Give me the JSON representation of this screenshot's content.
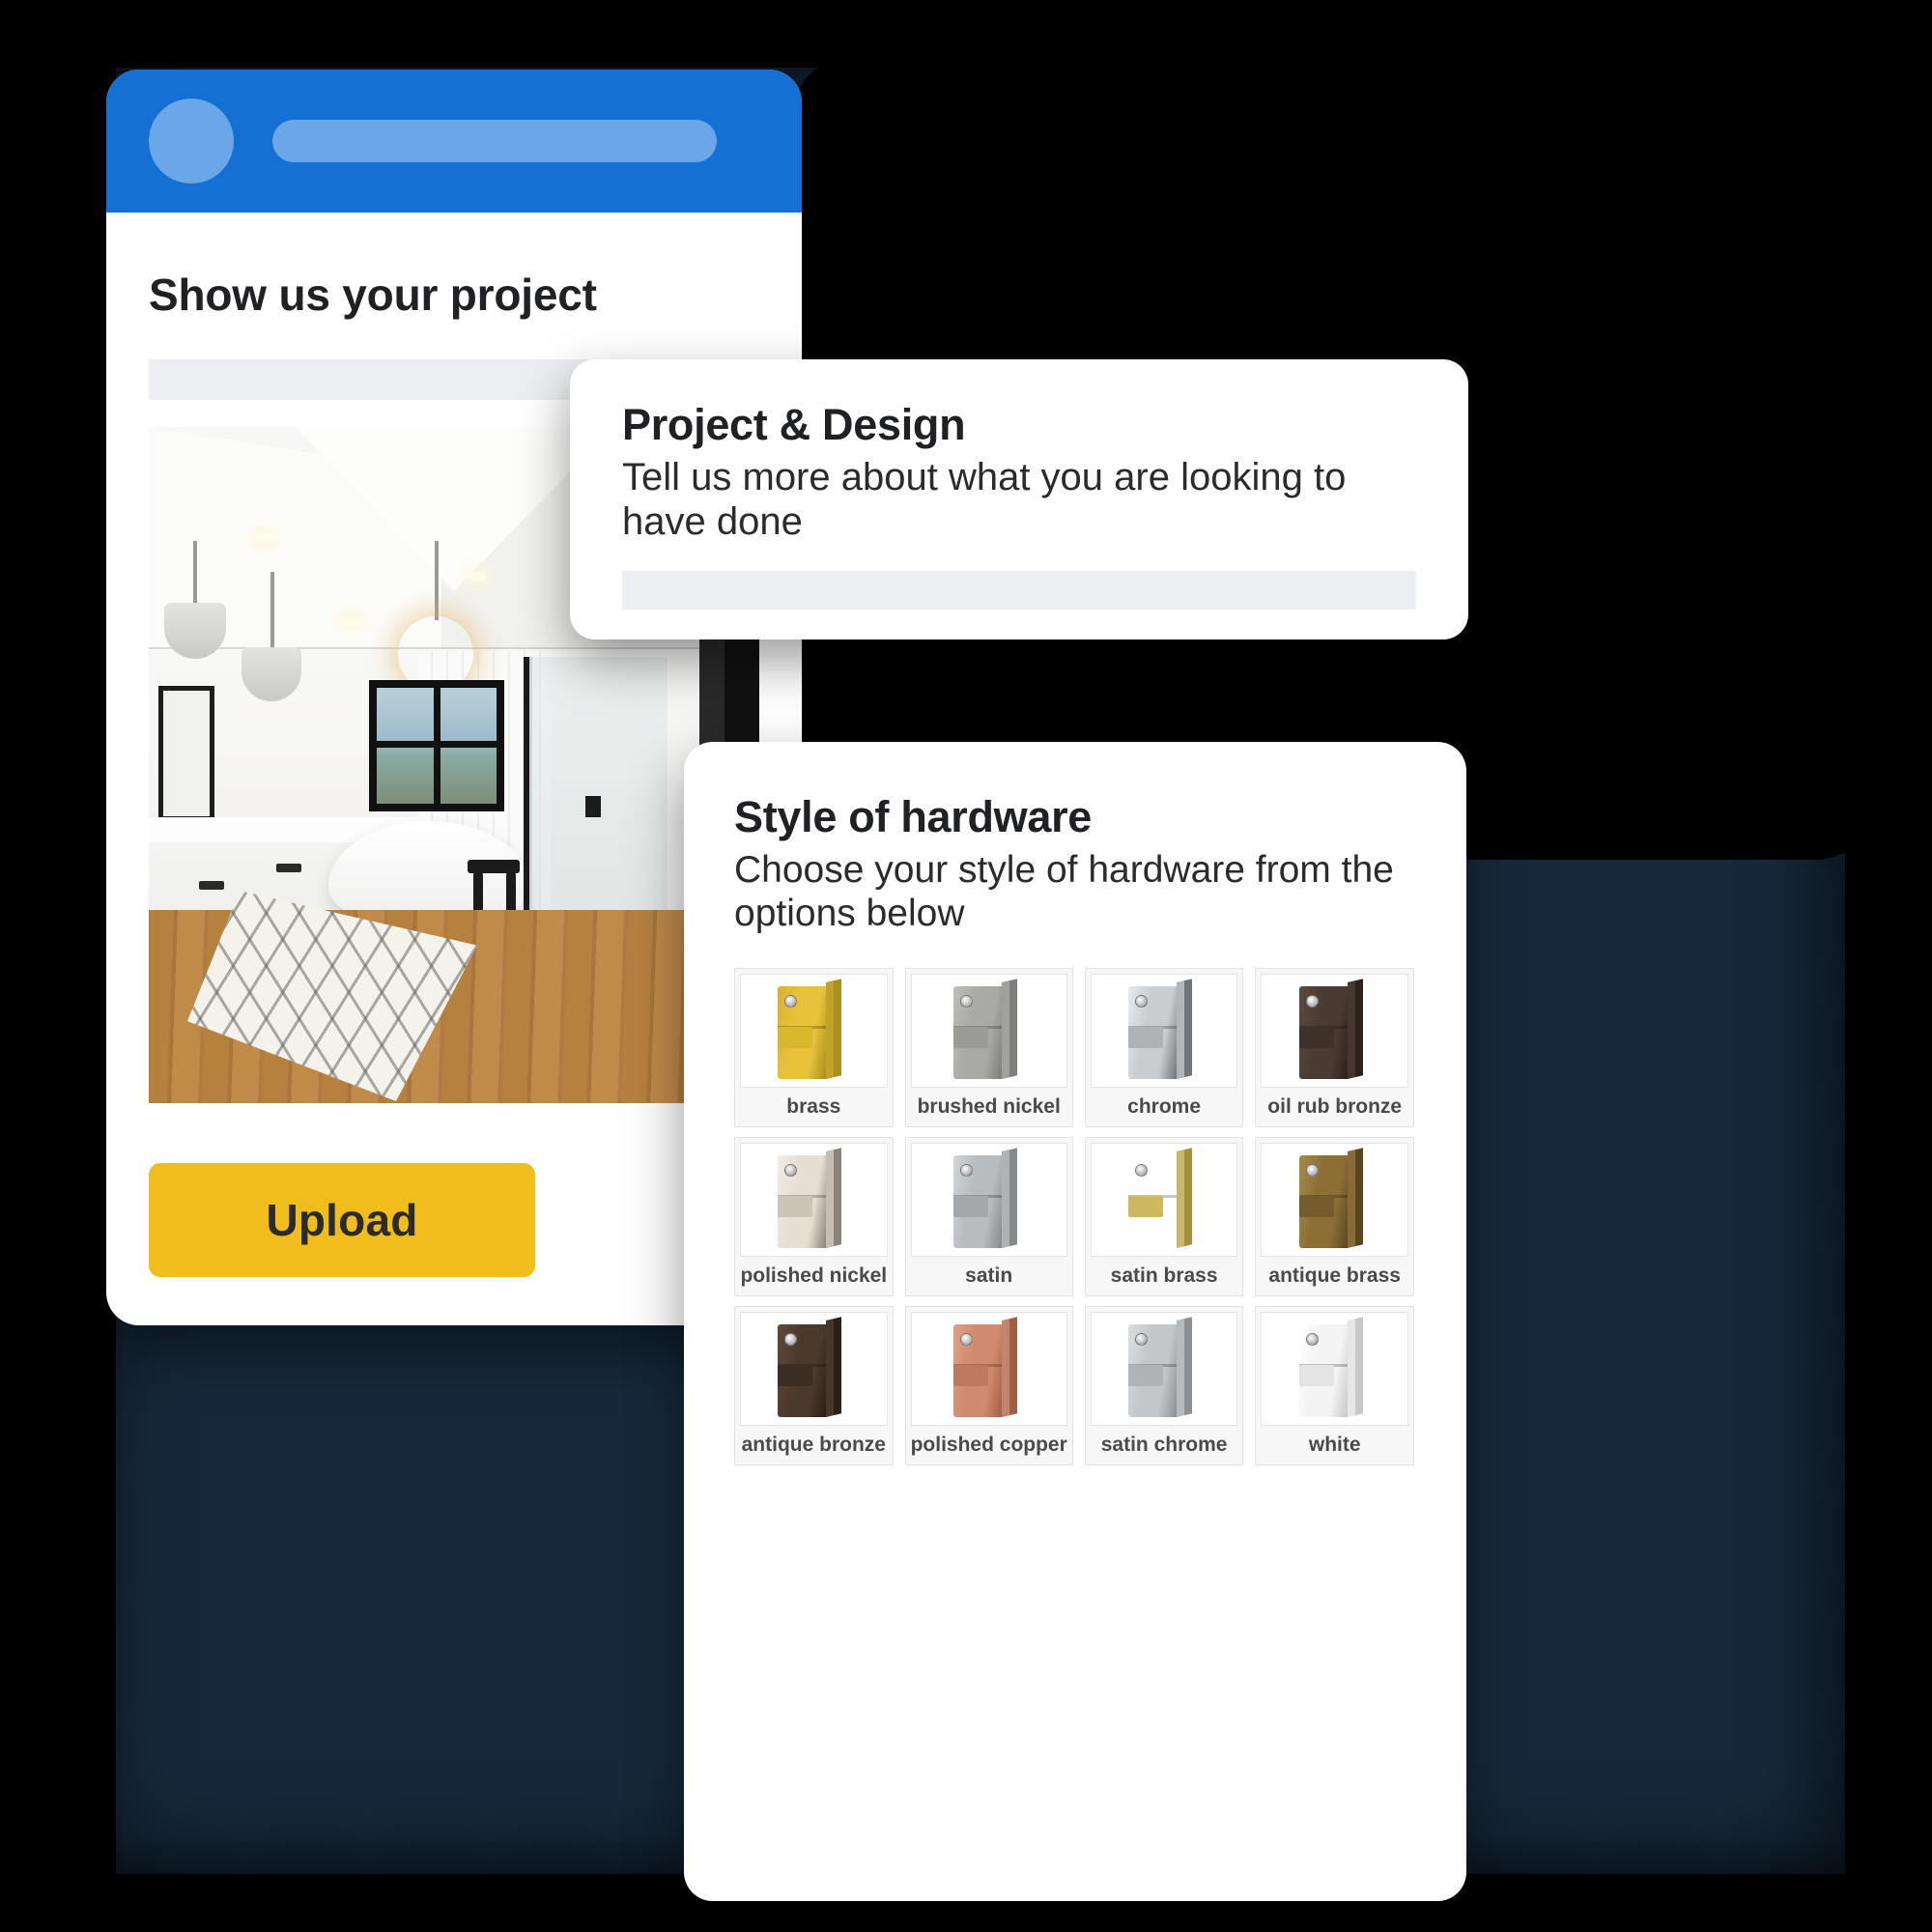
{
  "theme": {
    "backdrop_color": "#16293b",
    "header_blue": "#1470d3",
    "accent_yellow": "#f0bd1c",
    "placeholder_gray": "#eceef1"
  },
  "phone_card": {
    "header": {
      "avatar": "avatar-circle",
      "title_placeholder": "title-placeholder-bar"
    },
    "title": "Show us your project",
    "placeholder_bar": "",
    "photo_alt": "modern white bathroom with freestanding tub, pendant lights, vanity and patterned rug",
    "upload_label": "Upload"
  },
  "project_card": {
    "title": "Project & Design",
    "subtitle": "Tell us more about what you are looking to have done",
    "input_value": "",
    "input_placeholder": ""
  },
  "hardware_card": {
    "title": "Style of hardware",
    "subtitle": "Choose your style of hardware from the options below",
    "swatches": [
      {
        "label": "brass",
        "face": "#e8c33a",
        "side": "#a98f1d",
        "edge": "#d8b22f",
        "knuckle": "#d9b82f"
      },
      {
        "label": "brushed nickel",
        "face": "#a9a9a6",
        "side": "#7d7d7a",
        "edge": "#bdbdba",
        "knuckle": "#9a9a97"
      },
      {
        "label": "chrome",
        "face": "#c9cdd0",
        "side": "#6f7578",
        "edge": "#e8ebed",
        "knuckle": "#aeb3b6"
      },
      {
        "label": "oil rub bronze",
        "face": "#4a3b32",
        "side": "#2c231d",
        "edge": "#5d4a3e",
        "knuckle": "#3d312a"
      },
      {
        "label": "polished nickel",
        "face": "#e6ded2",
        "side": "#8c8378",
        "edge": "#f2ece2",
        "knuckle": "#cdc4b8"
      },
      {
        "label": "satin",
        "face": "#b9bcbe",
        "side": "#86898b",
        "edge": "#d2d5d7",
        "knuckle": "#a5a8aa"
      },
      {
        "label": "satin brass",
        "face": "#dcc濃",
        "side": "#a88f3e",
        "edge": "#e7d88a",
        "knuckle": "#cdb85f"
      },
      {
        "label": "antique brass",
        "face": "#8d6f36",
        "side": "#5b4622",
        "edge": "#a98948",
        "knuckle": "#765c2c"
      },
      {
        "label": "antique bronze",
        "face": "#4b3a2c",
        "side": "#2a2018",
        "edge": "#5e4a38",
        "knuckle": "#3c2e23"
      },
      {
        "label": "polished copper",
        "face": "#d08a70",
        "side": "#a25f47",
        "edge": "#e0a088",
        "knuckle": "#bd7a60"
      },
      {
        "label": "satin chrome",
        "face": "#c3c7ca",
        "side": "#8b9093",
        "edge": "#dcdfe1",
        "knuckle": "#b0b4b7"
      },
      {
        "label": "white",
        "face": "#f4f4f4",
        "side": "#c8c8c8",
        "edge": "#ffffff",
        "knuckle": "#e4e4e4"
      }
    ]
  }
}
